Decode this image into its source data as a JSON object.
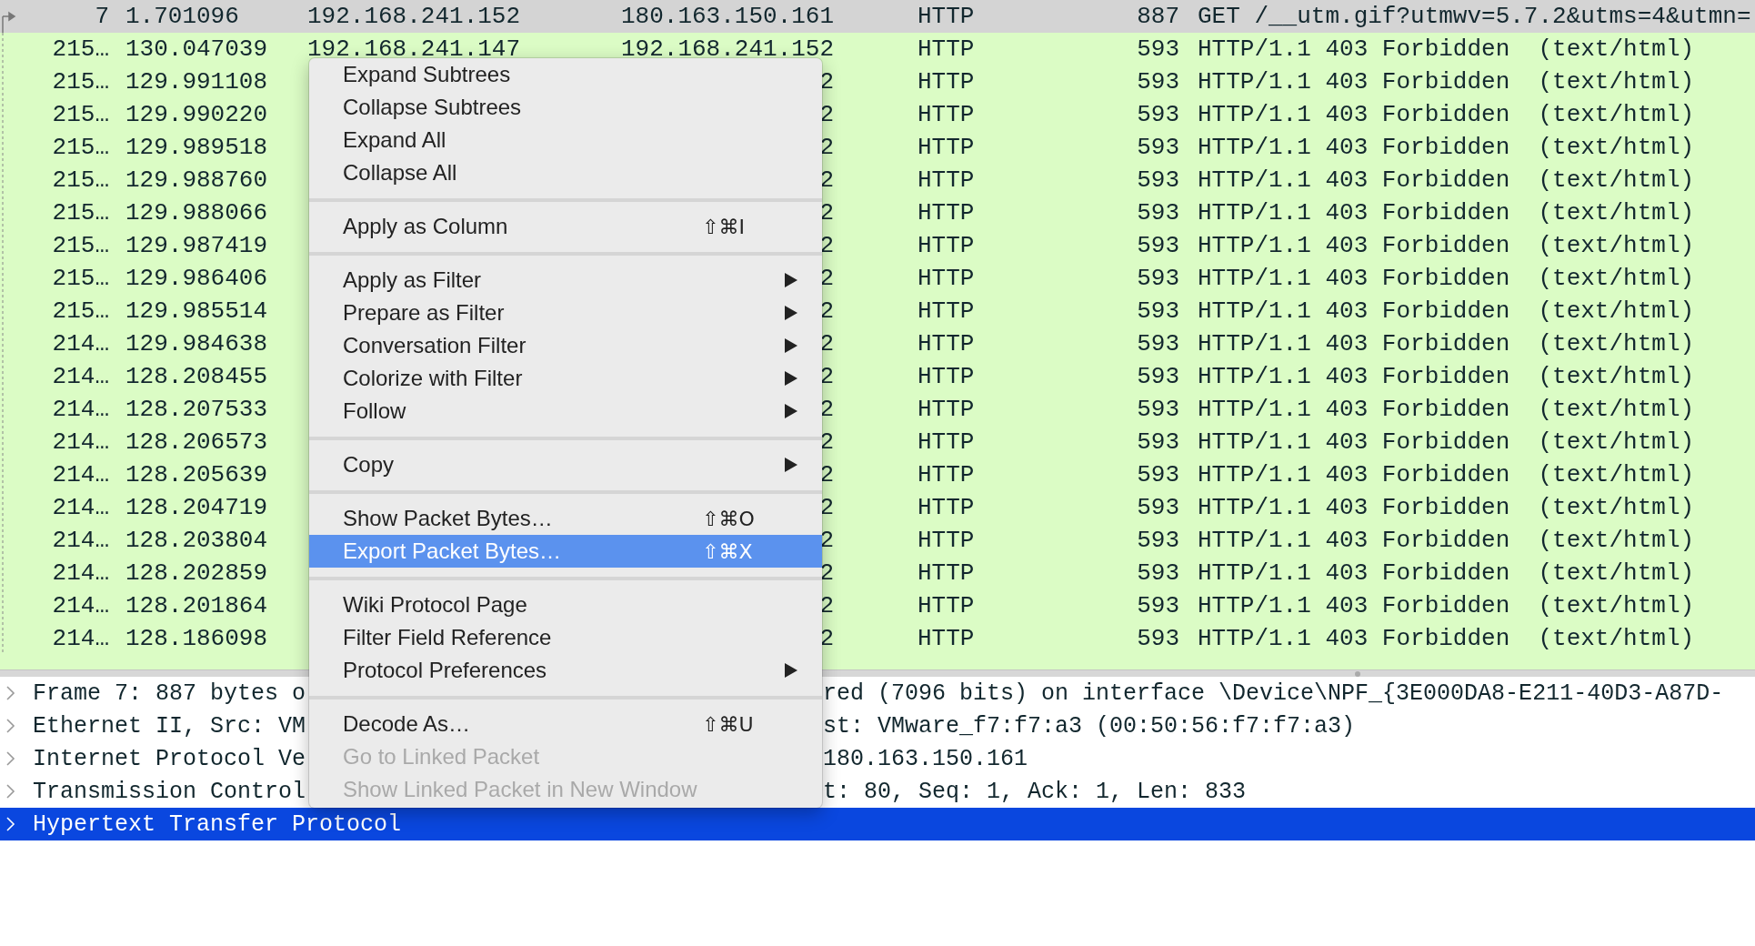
{
  "packet_list": {
    "rows": [
      {
        "no": "7",
        "time": "1.701096",
        "source": "192.168.241.152",
        "destination": "180.163.150.161",
        "protocol": "HTTP",
        "length": "887",
        "info": "GET /__utm.gif?utmwv=5.7.2&utms=4&utmn=",
        "selected": true
      },
      {
        "no": "215…",
        "time": "130.047039",
        "source": "192.168.241.147",
        "destination": "192.168.241.152",
        "protocol": "HTTP",
        "length": "593",
        "info": "HTTP/1.1 403 Forbidden  (text/html)",
        "selected": false
      },
      {
        "no": "215…",
        "time": "129.991108",
        "destination": "2",
        "protocol": "HTTP",
        "length": "593",
        "info": "HTTP/1.1 403 Forbidden  (text/html)",
        "selected": false
      },
      {
        "no": "215…",
        "time": "129.990220",
        "destination": "2",
        "protocol": "HTTP",
        "length": "593",
        "info": "HTTP/1.1 403 Forbidden  (text/html)",
        "selected": false
      },
      {
        "no": "215…",
        "time": "129.989518",
        "destination": "2",
        "protocol": "HTTP",
        "length": "593",
        "info": "HTTP/1.1 403 Forbidden  (text/html)",
        "selected": false
      },
      {
        "no": "215…",
        "time": "129.988760",
        "destination": "2",
        "protocol": "HTTP",
        "length": "593",
        "info": "HTTP/1.1 403 Forbidden  (text/html)",
        "selected": false
      },
      {
        "no": "215…",
        "time": "129.988066",
        "destination": "2",
        "protocol": "HTTP",
        "length": "593",
        "info": "HTTP/1.1 403 Forbidden  (text/html)",
        "selected": false
      },
      {
        "no": "215…",
        "time": "129.987419",
        "destination": "2",
        "protocol": "HTTP",
        "length": "593",
        "info": "HTTP/1.1 403 Forbidden  (text/html)",
        "selected": false
      },
      {
        "no": "215…",
        "time": "129.986406",
        "destination": "2",
        "protocol": "HTTP",
        "length": "593",
        "info": "HTTP/1.1 403 Forbidden  (text/html)",
        "selected": false
      },
      {
        "no": "215…",
        "time": "129.985514",
        "destination": "2",
        "protocol": "HTTP",
        "length": "593",
        "info": "HTTP/1.1 403 Forbidden  (text/html)",
        "selected": false
      },
      {
        "no": "214…",
        "time": "129.984638",
        "destination": "2",
        "protocol": "HTTP",
        "length": "593",
        "info": "HTTP/1.1 403 Forbidden  (text/html)",
        "selected": false
      },
      {
        "no": "214…",
        "time": "128.208455",
        "destination": "2",
        "protocol": "HTTP",
        "length": "593",
        "info": "HTTP/1.1 403 Forbidden  (text/html)",
        "selected": false
      },
      {
        "no": "214…",
        "time": "128.207533",
        "destination": "2",
        "protocol": "HTTP",
        "length": "593",
        "info": "HTTP/1.1 403 Forbidden  (text/html)",
        "selected": false
      },
      {
        "no": "214…",
        "time": "128.206573",
        "destination": "2",
        "protocol": "HTTP",
        "length": "593",
        "info": "HTTP/1.1 403 Forbidden  (text/html)",
        "selected": false
      },
      {
        "no": "214…",
        "time": "128.205639",
        "destination": "2",
        "protocol": "HTTP",
        "length": "593",
        "info": "HTTP/1.1 403 Forbidden  (text/html)",
        "selected": false
      },
      {
        "no": "214…",
        "time": "128.204719",
        "destination": "2",
        "protocol": "HTTP",
        "length": "593",
        "info": "HTTP/1.1 403 Forbidden  (text/html)",
        "selected": false
      },
      {
        "no": "214…",
        "time": "128.203804",
        "destination": "2",
        "protocol": "HTTP",
        "length": "593",
        "info": "HTTP/1.1 403 Forbidden  (text/html)",
        "selected": false
      },
      {
        "no": "214…",
        "time": "128.202859",
        "destination": "2",
        "protocol": "HTTP",
        "length": "593",
        "info": "HTTP/1.1 403 Forbidden  (text/html)",
        "selected": false
      },
      {
        "no": "214…",
        "time": "128.201864",
        "destination": "2",
        "protocol": "HTTP",
        "length": "593",
        "info": "HTTP/1.1 403 Forbidden  (text/html)",
        "selected": false
      },
      {
        "no": "214…",
        "time": "128.186098",
        "destination": "2",
        "protocol": "HTTP",
        "length": "593",
        "info": "HTTP/1.1 403 Forbidden  (text/html)",
        "selected": false
      }
    ]
  },
  "packet_details": [
    {
      "text": "Frame 7: 887 bytes o",
      "continuation": "red (7096 bits) on interface \\Device\\NPF_{3E000DA8-E211-40D3-A87D-",
      "selected": false
    },
    {
      "text": "Ethernet II, Src: VM",
      "continuation": "st: VMware_f7:f7:a3 (00:50:56:f7:f7:a3)",
      "selected": false
    },
    {
      "text": "Internet Protocol Ve",
      "continuation": "180.163.150.161",
      "selected": false
    },
    {
      "text": "Transmission Control",
      "continuation": "t: 80, Seq: 1, Ack: 1, Len: 833",
      "selected": false
    },
    {
      "text": "Hypertext Transfer Protocol",
      "selected": true
    }
  ],
  "context_menu": [
    {
      "kind": "item",
      "label": "Expand Subtrees",
      "submenu": false,
      "disabled": false,
      "selected": false
    },
    {
      "kind": "item",
      "label": "Collapse Subtrees",
      "submenu": false,
      "disabled": false,
      "selected": false
    },
    {
      "kind": "item",
      "label": "Expand All",
      "submenu": false,
      "disabled": false,
      "selected": false
    },
    {
      "kind": "item",
      "label": "Collapse All",
      "submenu": false,
      "disabled": false,
      "selected": false
    },
    {
      "kind": "separator"
    },
    {
      "kind": "item",
      "label": "Apply as Column",
      "shortcut": "⇧⌘I",
      "submenu": false,
      "disabled": false,
      "selected": false
    },
    {
      "kind": "separator"
    },
    {
      "kind": "item",
      "label": "Apply as Filter",
      "submenu": true,
      "disabled": false,
      "selected": false
    },
    {
      "kind": "item",
      "label": "Prepare as Filter",
      "submenu": true,
      "disabled": false,
      "selected": false
    },
    {
      "kind": "item",
      "label": "Conversation Filter",
      "submenu": true,
      "disabled": false,
      "selected": false
    },
    {
      "kind": "item",
      "label": "Colorize with Filter",
      "submenu": true,
      "disabled": false,
      "selected": false
    },
    {
      "kind": "item",
      "label": "Follow",
      "submenu": true,
      "disabled": false,
      "selected": false
    },
    {
      "kind": "separator"
    },
    {
      "kind": "item",
      "label": "Copy",
      "submenu": true,
      "disabled": false,
      "selected": false
    },
    {
      "kind": "separator"
    },
    {
      "kind": "item",
      "label": "Show Packet Bytes…",
      "shortcut": "⇧⌘O",
      "submenu": false,
      "disabled": false,
      "selected": false
    },
    {
      "kind": "item",
      "label": "Export Packet Bytes…",
      "shortcut": "⇧⌘X",
      "submenu": false,
      "disabled": false,
      "selected": true
    },
    {
      "kind": "separator"
    },
    {
      "kind": "item",
      "label": "Wiki Protocol Page",
      "submenu": false,
      "disabled": false,
      "selected": false
    },
    {
      "kind": "item",
      "label": "Filter Field Reference",
      "submenu": false,
      "disabled": false,
      "selected": false
    },
    {
      "kind": "item",
      "label": "Protocol Preferences",
      "submenu": true,
      "disabled": false,
      "selected": false
    },
    {
      "kind": "separator"
    },
    {
      "kind": "item",
      "label": "Decode As…",
      "shortcut": "⇧⌘U",
      "submenu": false,
      "disabled": false,
      "selected": false
    },
    {
      "kind": "item",
      "label": "Go to Linked Packet",
      "submenu": false,
      "disabled": true,
      "selected": false
    },
    {
      "kind": "item",
      "label": "Show Linked Packet in New Window",
      "submenu": false,
      "disabled": true,
      "selected": false
    }
  ]
}
